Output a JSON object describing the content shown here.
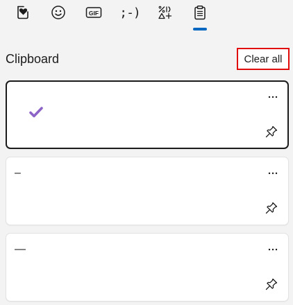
{
  "tabs": [
    {
      "name": "favorites-tab",
      "icon": "heart-in-bookmark-icon"
    },
    {
      "name": "emoji-tab",
      "icon": "smiley-face-icon"
    },
    {
      "name": "gif-tab",
      "icon": "gif-icon",
      "label": "GIF"
    },
    {
      "name": "kaomoji-tab",
      "icon": "kaomoji-icon",
      "label": ";-)"
    },
    {
      "name": "symbols-tab",
      "icon": "symbols-icon"
    },
    {
      "name": "clipboard-tab",
      "icon": "clipboard-icon",
      "selected": true
    }
  ],
  "accent_color": "#0067c0",
  "header": {
    "title": "Clipboard",
    "clear_all_label": "Clear all"
  },
  "clipboard_items": [
    {
      "content": "✔",
      "content_icon": "purple-check-mark-icon",
      "content_color": "#8c63c6",
      "selected": true
    },
    {
      "content": "–",
      "selected": false
    },
    {
      "content": "—",
      "selected": false
    }
  ]
}
